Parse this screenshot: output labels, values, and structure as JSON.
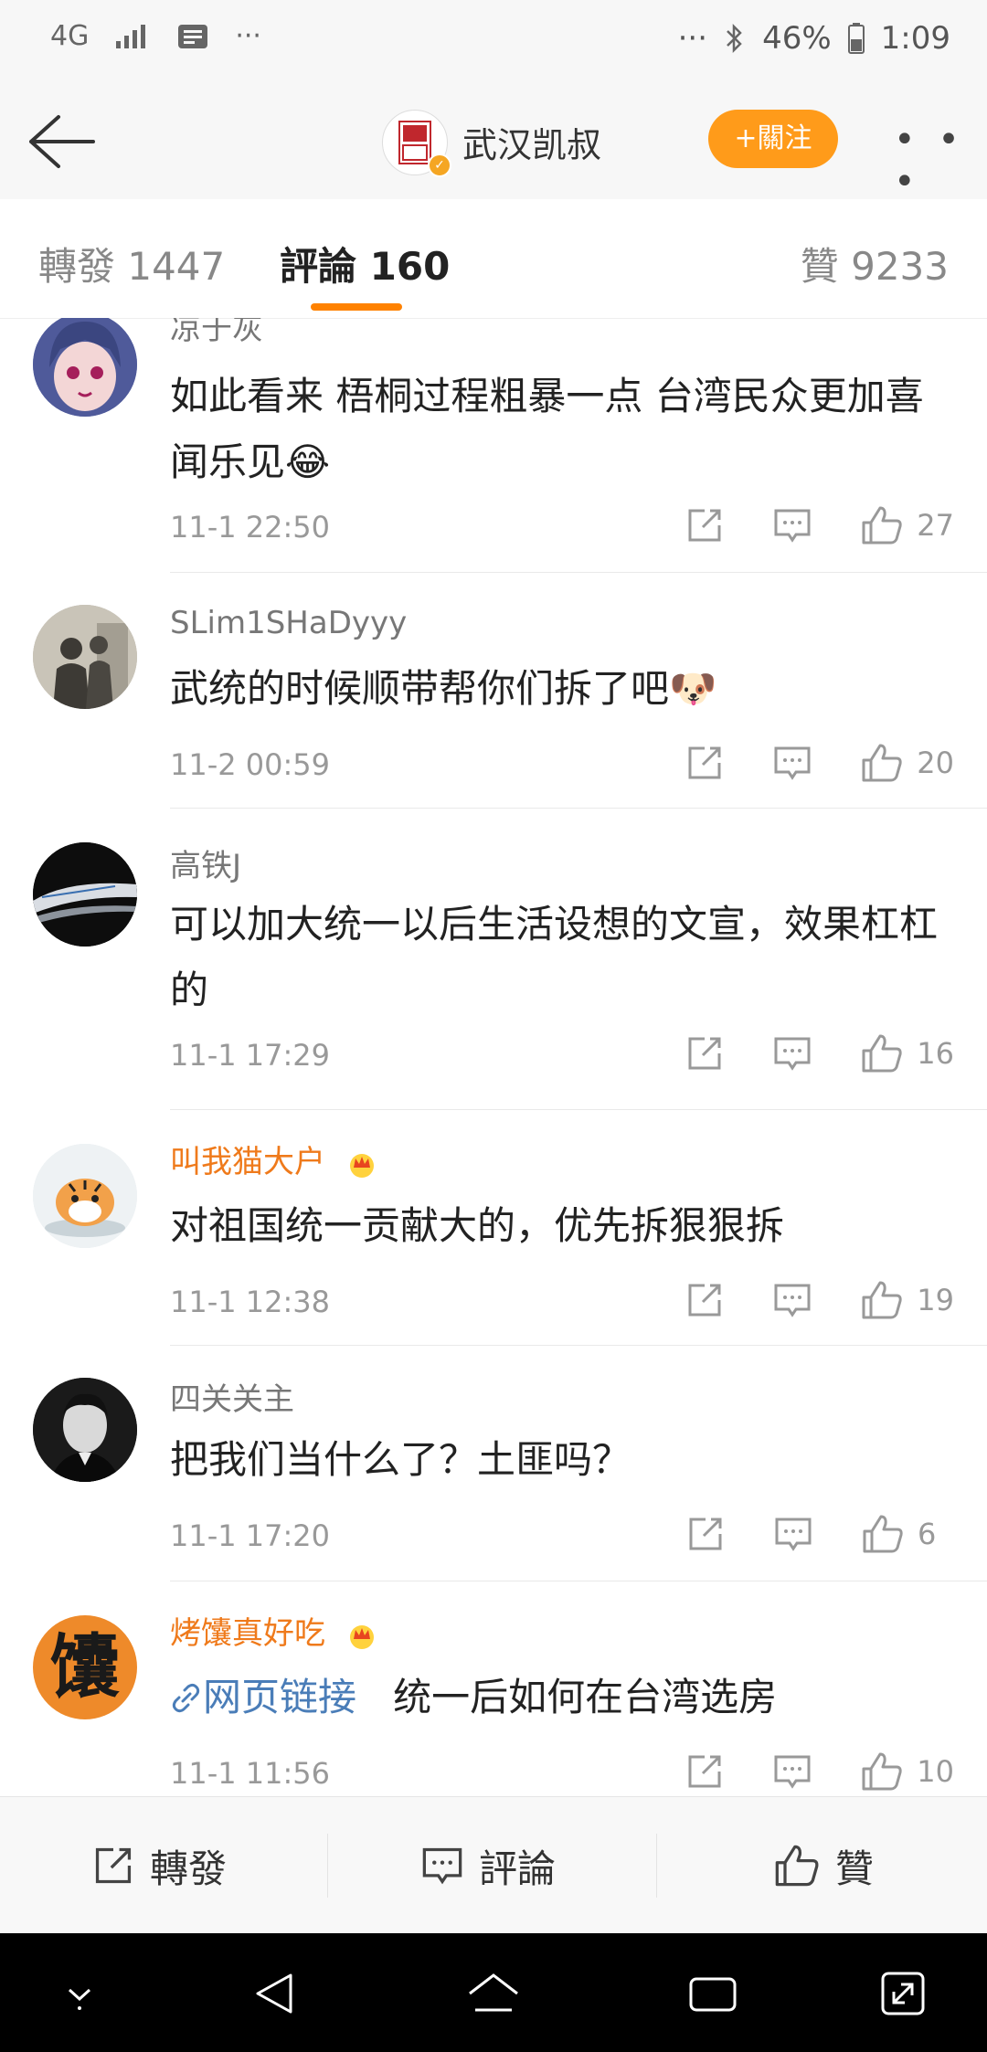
{
  "status_bar": {
    "network": "4G",
    "dots": "···",
    "battery": "46%",
    "time": "1:09"
  },
  "header": {
    "account_name": "武汉凯叔",
    "avatar_text": "武汉凯叔",
    "follow_label": "+關注",
    "more_label": "• • •"
  },
  "tabs": [
    {
      "label": "轉發 1447"
    },
    {
      "label": "評論 160"
    },
    {
      "label": "贊 9233"
    }
  ],
  "comments": [
    {
      "author": "凉于灰",
      "text": "如此看来 梧桐过程粗暴一点 台湾民众更加喜闻乐见😂",
      "time": "11-1 22:50",
      "likes": "27"
    },
    {
      "author": "SLim1SHaDyyy",
      "text": "武统的时候顺带帮你们拆了吧🐶",
      "time": "11-2 00:59",
      "likes": "20"
    },
    {
      "author": "高铁J",
      "text": "可以加大统一以后生活设想的文宣，效果杠杠的",
      "time": "11-1 17:29",
      "likes": "16"
    },
    {
      "author": "叫我猫大户",
      "text": "对祖国统一贡献大的，优先拆狠狠拆",
      "time": "11-1 12:38",
      "likes": "19"
    },
    {
      "author": "四关关主",
      "text": "把我们当什么了？土匪吗？",
      "time": "11-1 17:20",
      "likes": "6"
    },
    {
      "author": "烤馕真好吃",
      "link_label": "网页链接",
      "text": "统一后如何在台湾选房",
      "time": "11-1 11:56",
      "likes": "10"
    }
  ],
  "avatar_glyph_5": "馕",
  "bottom_bar": {
    "repost": "轉發",
    "comment": "評論",
    "like": "贊"
  }
}
